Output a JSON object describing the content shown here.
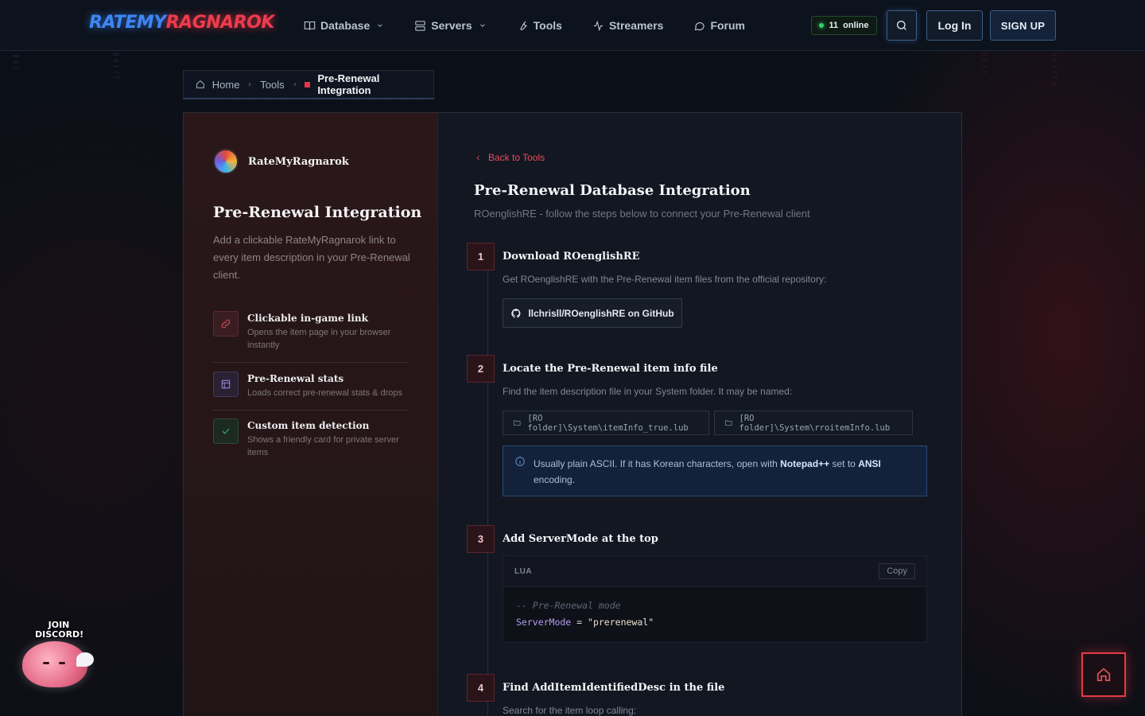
{
  "brand": {
    "logo_part1": "RATEMY",
    "logo_part2": "RAGNAROK"
  },
  "nav": {
    "items": [
      {
        "label": "Database",
        "icon": "book-icon",
        "dropdown": true
      },
      {
        "label": "Servers",
        "icon": "server-icon",
        "dropdown": true
      },
      {
        "label": "Tools",
        "icon": "wrench-icon",
        "dropdown": false
      },
      {
        "label": "Streamers",
        "icon": "activity-icon",
        "dropdown": false
      },
      {
        "label": "Forum",
        "icon": "chat-bubble-icon",
        "dropdown": false
      }
    ],
    "online_count": "11",
    "online_label": "online",
    "login_label": "Log In",
    "signup_label": "SIGN UP"
  },
  "breadcrumb": {
    "home": "Home",
    "tools": "Tools",
    "current": "Pre-Renewal Integration"
  },
  "sidebar": {
    "brand_name": "RateMyRagnarok",
    "title": "Pre-Renewal Integration",
    "description": "Add a clickable RateMyRagnarok link to every item description in your Pre-Renewal client.",
    "features": [
      {
        "title": "Clickable in-game link",
        "subtitle": "Opens the item page in your browser instantly",
        "icon": "link-icon",
        "color": "#e2505e"
      },
      {
        "title": "Pre-Renewal stats",
        "subtitle": "Loads correct pre-renewal stats & drops",
        "icon": "layout-icon",
        "color": "#9b86d8"
      },
      {
        "title": "Custom item detection",
        "subtitle": "Shows a friendly card for private server items",
        "icon": "check-icon",
        "color": "#3fbf6a"
      }
    ]
  },
  "main": {
    "back_label": "Back to Tools",
    "title": "Pre-Renewal Database Integration",
    "subtitle": "ROenglishRE - follow the steps below to connect your Pre-Renewal client",
    "steps": [
      {
        "num": "1",
        "title": "Download ROenglishRE",
        "text": "Get ROenglishRE with the Pre-Renewal item files from the official repository:",
        "button": "llchrisll/ROenglishRE on GitHub"
      },
      {
        "num": "2",
        "title": "Locate the Pre-Renewal item info file",
        "text": "Find the item description file in your System folder. It may be named:",
        "paths": [
          "[RO folder]\\System\\itemInfo_true.lub",
          "[RO folder]\\System\\rroitemInfo.lub"
        ],
        "note_pre": "Usually plain ASCII. If it has Korean characters, open with ",
        "note_bold1": "Notepad++",
        "note_mid": " set to ",
        "note_bold2": "ANSI",
        "note_post": " encoding."
      },
      {
        "num": "3",
        "title": "Add ServerMode at the top",
        "code_lang": "LUA",
        "copy_label": "Copy",
        "code_comment": "-- Pre-Renewal mode",
        "code_var": "ServerMode",
        "code_op": " = ",
        "code_str": "\"prerenewal\""
      },
      {
        "num": "4",
        "title": "Find AddItemIdentifiedDesc in the file",
        "text": "Search for the item loop calling:"
      }
    ]
  },
  "floating": {
    "discord_label": "JOIN DISCORD!"
  }
}
